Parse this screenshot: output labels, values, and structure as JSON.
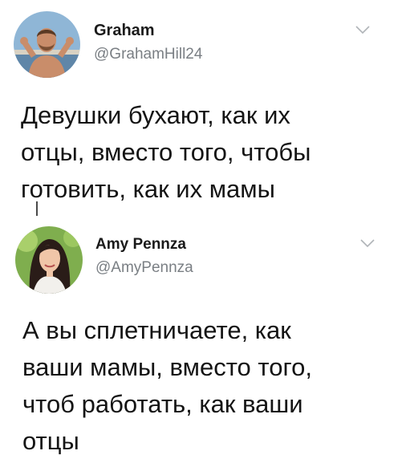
{
  "tweets": [
    {
      "display_name": "Graham",
      "handle": "@GrahamHill24",
      "avatar_icon": "profile-photo-graham",
      "menu_icon": "chevron-down-icon",
      "text_lines": [
        "Девушки бухают, как их",
        "отцы, вместо того, чтобы",
        "готовить, как их мамы"
      ]
    },
    {
      "display_name": "Amy Pennza",
      "handle": "@AmyPennza",
      "avatar_icon": "profile-photo-amy",
      "menu_icon": "chevron-down-icon",
      "text_lines": [
        "А вы сплетничаете, как",
        "ваши мамы, вместо того,",
        "чтоб работать, как ваши",
        "отцы"
      ]
    }
  ],
  "colors": {
    "background": "#ffffff",
    "text": "#141414",
    "handle": "#7a7f84",
    "chevron": "#b0b4b8",
    "thread_line": "#4a4a4a"
  }
}
